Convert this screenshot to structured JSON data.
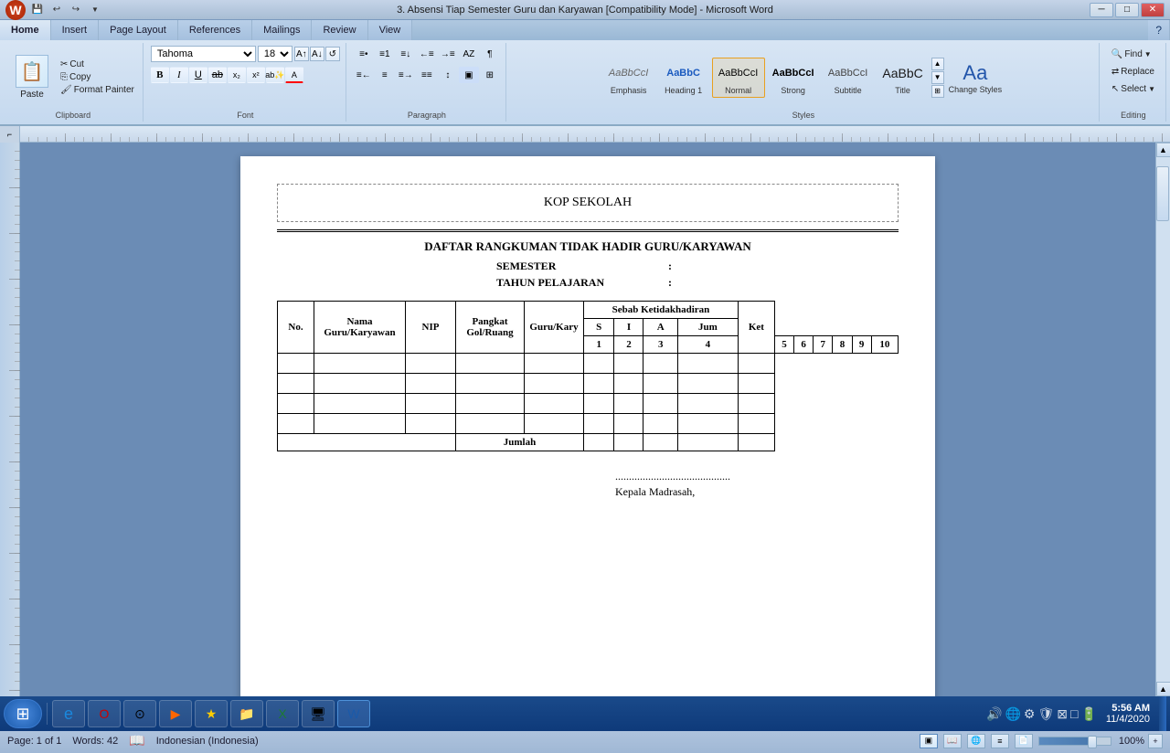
{
  "titlebar": {
    "title": "3. Absensi Tiap Semester Guru dan Karyawan [Compatibility Mode] - Microsoft Word",
    "quickaccess": {
      "save": "💾",
      "undo": "↩",
      "redo": "↪"
    },
    "controls": {
      "min": "─",
      "max": "□",
      "close": "✕"
    }
  },
  "ribbon": {
    "tabs": [
      "Home",
      "Insert",
      "Page Layout",
      "References",
      "Mailings",
      "Review",
      "View"
    ],
    "active_tab": "Home",
    "clipboard": {
      "label": "Clipboard",
      "paste": "Paste",
      "cut": "Cut",
      "copy": "Copy",
      "format_painter": "Format Painter"
    },
    "font": {
      "label": "Font",
      "font_name": "Tahoma",
      "font_size": "18",
      "bold": "B",
      "italic": "I",
      "underline": "U",
      "strikethrough": "ab",
      "subscript": "x₂",
      "superscript": "x²",
      "highlight": "A",
      "font_color": "A"
    },
    "paragraph": {
      "label": "Paragraph"
    },
    "styles": {
      "label": "Styles",
      "items": [
        {
          "name": "Emphasis",
          "preview": "AaBbCcI",
          "active": false
        },
        {
          "name": "Heading 1",
          "preview": "AaBbC",
          "active": false
        },
        {
          "name": "Normal",
          "preview": "AaBbCcI",
          "active": true
        },
        {
          "name": "Strong",
          "preview": "AaBbCcI",
          "active": false
        },
        {
          "name": "Subtitle",
          "preview": "AaBbCcI",
          "active": false
        },
        {
          "name": "Title",
          "preview": "AaBbC",
          "active": false
        }
      ],
      "change_styles": "Change Styles"
    },
    "editing": {
      "label": "Editing",
      "find": "Find",
      "replace": "Replace",
      "select": "Select"
    }
  },
  "document": {
    "kop": "KOP SEKOLAH",
    "main_title": "DAFTAR RANGKUMAN TIDAK HADIR GURU/KARYAWAN",
    "semester_label": "SEMESTER",
    "semester_value": "",
    "tahun_label": "TAHUN PELAJARAN",
    "tahun_value": "",
    "table": {
      "headers_row1": [
        "No.",
        "Nama Guru/Karyawan",
        "NIP",
        "Pangkat Gol/Ruang",
        "Guru/Kary",
        "Sebab Ketidakhadiran",
        "",
        "",
        "",
        "Ket"
      ],
      "headers_row2": [
        "",
        "",
        "",
        "",
        "",
        "S",
        "I",
        "A",
        "Jum",
        ""
      ],
      "numbers_row": [
        "1",
        "2",
        "3",
        "4",
        "5",
        "6",
        "7",
        "8",
        "9",
        "10"
      ],
      "jumlah": "Jumlah"
    },
    "signature": {
      "dots": "..........................................",
      "title": "Kepala Madrasah,"
    }
  },
  "statusbar": {
    "page": "Page: 1 of 1",
    "words": "Words: 42",
    "language": "Indonesian (Indonesia)",
    "zoom": "100%"
  },
  "taskbar": {
    "time": "5:56 AM",
    "date": "11/4/2020",
    "apps": [
      "🌐",
      "🔴",
      "⚪",
      "🟢",
      "▶",
      "⭐",
      "📁",
      "📊",
      "📝"
    ]
  }
}
